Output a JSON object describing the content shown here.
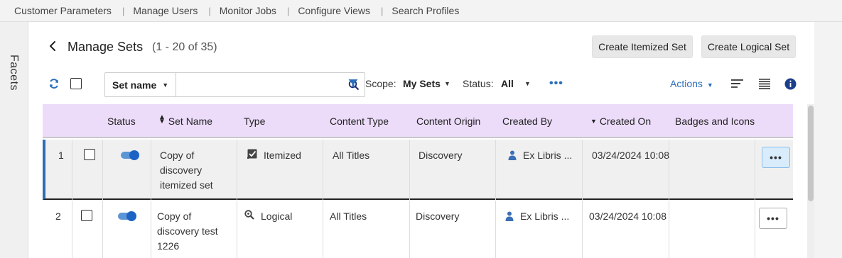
{
  "topnav": {
    "items": [
      "Customer Parameters",
      "Manage Users",
      "Monitor Jobs",
      "Configure Views",
      "Search Profiles"
    ]
  },
  "facets": {
    "label": "Facets"
  },
  "header": {
    "title": "Manage Sets",
    "count": "(1 - 20 of 35)",
    "create_itemized": "Create Itemized Set",
    "create_logical": "Create Logical Set"
  },
  "toolbar": {
    "search_field": "Set name",
    "search_value": "",
    "scope_label": "Scope:",
    "scope_value": "My Sets",
    "status_label": "Status:",
    "status_value": "All",
    "more": "•••",
    "actions": "Actions"
  },
  "table": {
    "headers": {
      "status": "Status",
      "set_name": "Set Name",
      "type": "Type",
      "content_type": "Content Type",
      "content_origin": "Content Origin",
      "created_by": "Created By",
      "created_on": "Created On",
      "badges": "Badges and Icons"
    },
    "rows": [
      {
        "num": "1",
        "active": true,
        "name": "Copy of discovery itemized set",
        "type": "Itemized",
        "type_icon": "itemized-set-icon",
        "content_type": "All Titles",
        "content_origin": "Discovery",
        "created_by": "Ex Libris ...",
        "created_on": "03/24/2024 10:08",
        "more": "•••"
      },
      {
        "num": "2",
        "active": true,
        "name": "Copy of discovery test 1226",
        "type": "Logical",
        "type_icon": "logical-set-icon",
        "content_type": "All Titles",
        "content_origin": "Discovery",
        "created_by": "Ex Libris ...",
        "created_on": "03/24/2024 10:08",
        "more": "•••"
      }
    ]
  },
  "colors": {
    "header_bg": "#ecdcfa",
    "accent": "#2a6ebb",
    "toggle_on": "#1c63c4",
    "selected_row_bar": "#2e6db5"
  }
}
